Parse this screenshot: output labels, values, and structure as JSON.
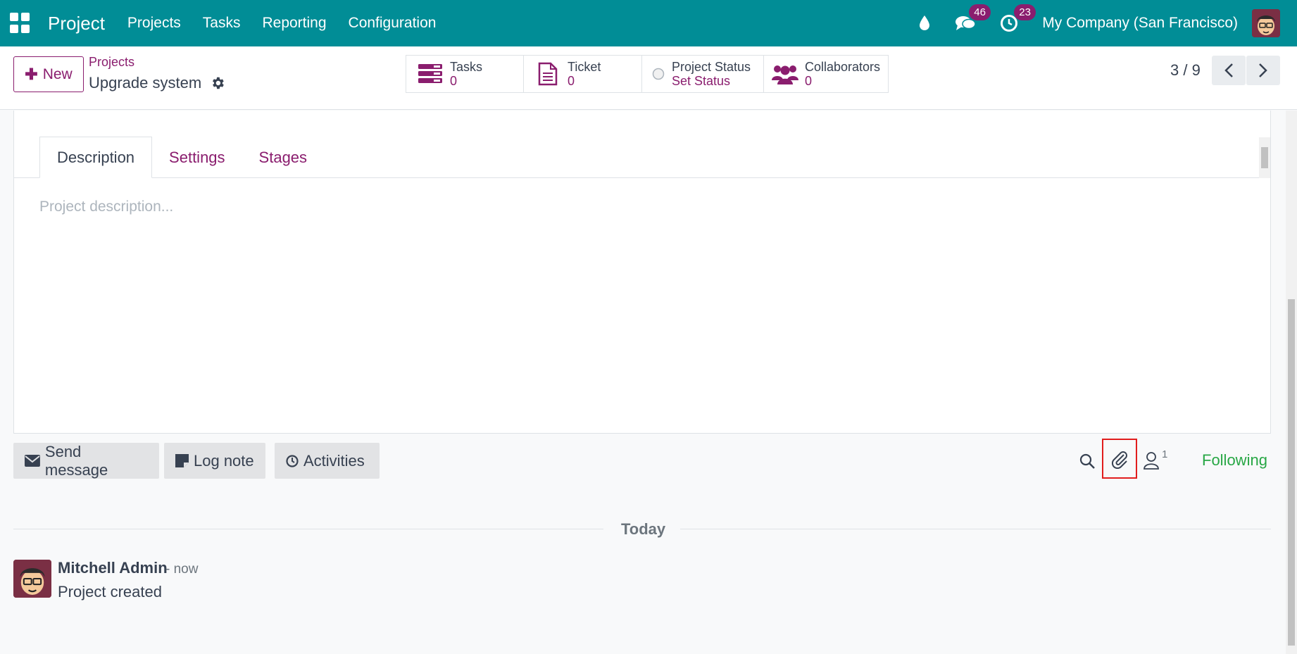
{
  "navbar": {
    "brand": "Project",
    "menu": [
      "Projects",
      "Tasks",
      "Reporting",
      "Configuration"
    ],
    "messages_count": "46",
    "activities_count": "23",
    "company": "My Company (San Francisco)"
  },
  "control": {
    "new_label": "New",
    "breadcrumb_parent": "Projects",
    "record_name": "Upgrade system",
    "pager": "3 / 9"
  },
  "smart_buttons": [
    {
      "label": "Tasks",
      "value": "0",
      "icon": "tasks-icon"
    },
    {
      "label": "Ticket",
      "value": "0",
      "icon": "ticket-icon"
    },
    {
      "label": "Project Status",
      "value": "Set Status",
      "icon": "status-radio-icon"
    },
    {
      "label": "Collaborators",
      "value": "0",
      "icon": "users-icon"
    }
  ],
  "tabs": [
    "Description",
    "Settings",
    "Stages"
  ],
  "description_placeholder": "Project description...",
  "chatter": {
    "send_message": "Send message",
    "log_note": "Log note",
    "activities": "Activities",
    "follower_count": "1",
    "following": "Following",
    "date_separator": "Today",
    "messages": [
      {
        "author": "Mitchell Admin",
        "date": "- now",
        "body": "Project created"
      }
    ]
  },
  "colors": {
    "navbar": "#018d96",
    "accent": "#8a1d6e",
    "following": "#28a745",
    "highlight": "#e11d1d"
  }
}
